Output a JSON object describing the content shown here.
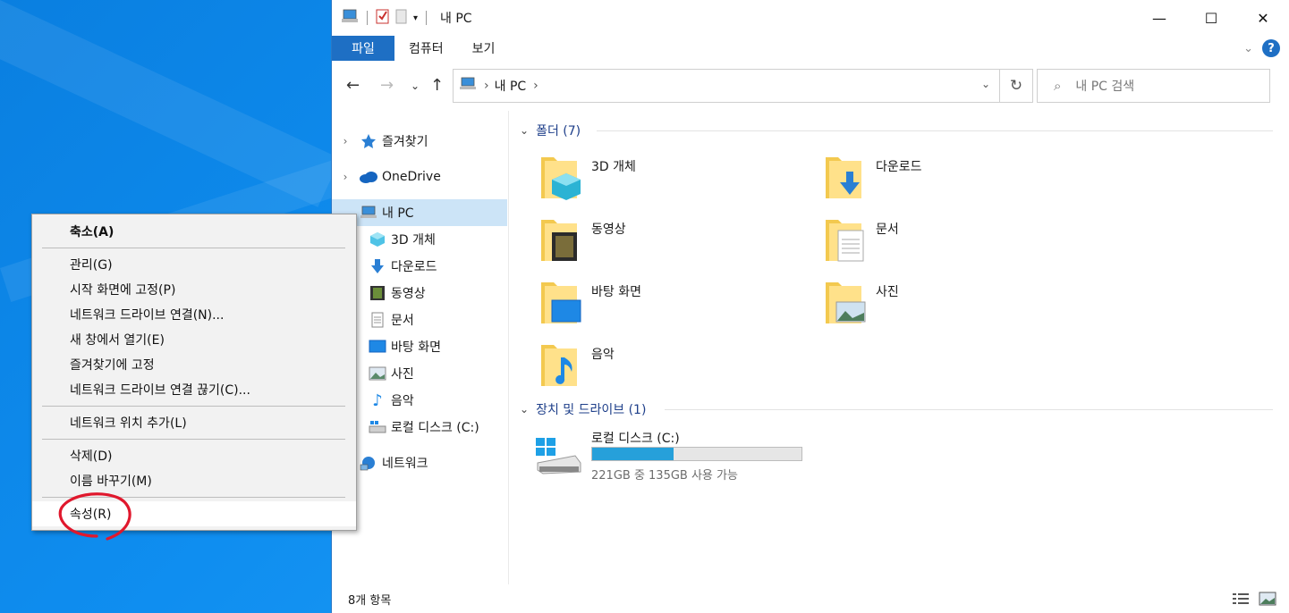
{
  "window": {
    "title": "내 PC",
    "controls": {
      "minimize": "—",
      "maximize": "☐",
      "close": "✕"
    }
  },
  "ribbon": {
    "tabs": [
      "파일",
      "컴퓨터",
      "보기"
    ],
    "help": "?"
  },
  "address": {
    "crumb": "내 PC",
    "search_placeholder": "내 PC 검색"
  },
  "nav_pane": {
    "items": [
      {
        "label": "즐겨찾기",
        "icon": "star-icon"
      },
      {
        "label": "OneDrive",
        "icon": "cloud-icon"
      },
      {
        "label": "내 PC",
        "icon": "computer-icon"
      },
      {
        "label": "3D 개체",
        "icon": "cube-icon"
      },
      {
        "label": "다운로드",
        "icon": "download-icon"
      },
      {
        "label": "동영상",
        "icon": "film-icon"
      },
      {
        "label": "문서",
        "icon": "document-icon"
      },
      {
        "label": "바탕 화면",
        "icon": "desktop-icon"
      },
      {
        "label": "사진",
        "icon": "picture-icon"
      },
      {
        "label": "음악",
        "icon": "music-icon"
      },
      {
        "label": "로컬 디스크 (C:)",
        "icon": "drive-icon"
      },
      {
        "label": "네트워크",
        "icon": "network-icon"
      }
    ]
  },
  "content": {
    "folders_header": "폴더 (7)",
    "folders": [
      "3D 개체",
      "다운로드",
      "동영상",
      "문서",
      "바탕 화면",
      "사진",
      "음악"
    ],
    "devices_header": "장치 및 드라이브 (1)",
    "drive": {
      "name": "로컬 디스크 (C:)",
      "free_text": "221GB 중 135GB 사용 가능",
      "used_fraction": 0.39
    }
  },
  "status": {
    "count": "8개 항목"
  },
  "context_menu": {
    "items": [
      "축소(A)",
      "관리(G)",
      "시작 화면에 고정(P)",
      "네트워크 드라이브 연결(N)...",
      "새 창에서 열기(E)",
      "즐겨찾기에 고정",
      "네트워크 드라이브 연결 끊기(C)...",
      "네트워크 위치 추가(L)",
      "삭제(D)",
      "이름 바꾸기(M)",
      "속성(R)"
    ]
  },
  "colors": {
    "accent": "#1e6fc4",
    "selection": "#cce4f7",
    "drive_bar": "#26a0da",
    "annotation": "#e0182d"
  }
}
